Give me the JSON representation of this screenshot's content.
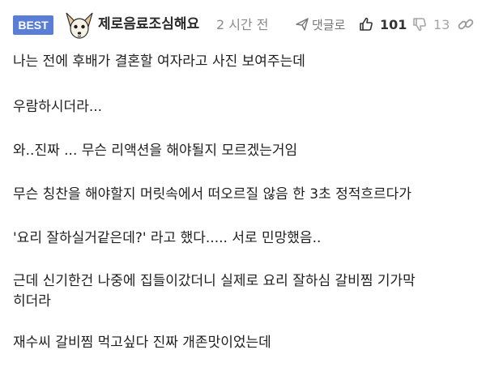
{
  "comment": {
    "badge": "BEST",
    "nickname": "제로음료조심해요",
    "time": "2 시간 전",
    "reply_label": "댓글로",
    "likes": "101",
    "dislikes": "13",
    "lines": [
      "나는 전에 후배가 결혼할 여자라고 사진 보여주는데",
      "우람하시더라...",
      "와..진짜 ... 무슨 리액션을 해야될지 모르겠는거임",
      "무슨 칭찬을 해야할지 머릿속에서 떠오르질 않음 한 3초 정적흐르다가",
      "'요리 잘하실거같은데?' 라고 했다..... 서로 민망했음..",
      "근데 신기한건 나중에 집들이갔더니 실제로 요리 잘하심 갈비찜 기가막",
      "히더라",
      "재수씨 갈비찜 먹고싶다 진짜 개존맛이었는데"
    ]
  },
  "colors": {
    "badge_bg": "#5a7ed6",
    "meta_text": "#8a8a8a",
    "body_text": "#1e1e1e"
  },
  "icons": {
    "reply": "send-arrow-icon",
    "like": "thumbs-up-icon",
    "dislike": "thumbs-down-icon",
    "link": "link-chain-icon"
  }
}
